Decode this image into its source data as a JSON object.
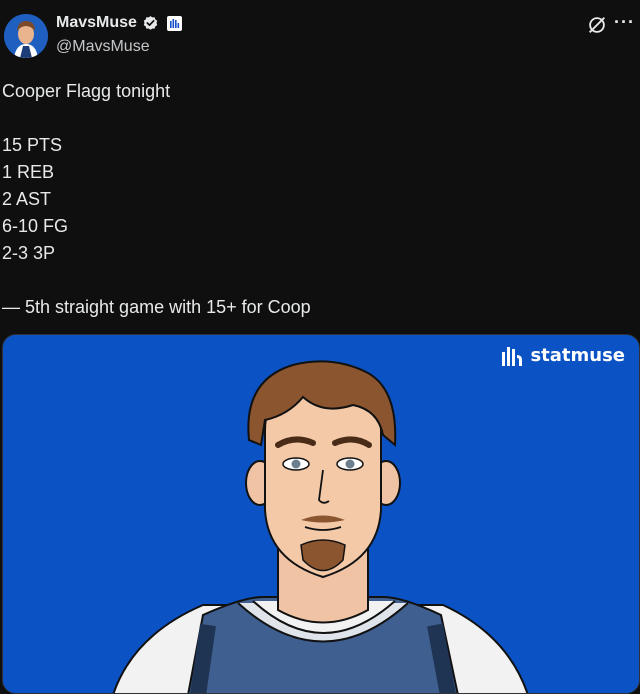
{
  "author": {
    "display_name": "MavsMuse",
    "handle": "@MavsMuse",
    "avatar_icon": "avatar-player-icon",
    "verified_icon": "verified-badge-icon",
    "affiliate_icon": "statmuse-affiliate-icon"
  },
  "header_icons": {
    "grok": "grok-icon",
    "more": "more-options-icon"
  },
  "tweet": {
    "line1": "Cooper Flagg tonight",
    "stats": [
      "15 PTS",
      "1 REB",
      "2 AST",
      "6-10 FG",
      "2-3 3P"
    ],
    "footer": "— 5th straight game with 15+ for Coop"
  },
  "media": {
    "watermark": "statmuse",
    "watermark_icon": "statmuse-logo-icon",
    "background_color": "#0b52c4",
    "subject": "player-illustration"
  },
  "colors": {
    "background": "#0f0f0f",
    "text": "#e7e9ea",
    "verified": "#e7e9ea",
    "media_bg": "#0b52c4"
  }
}
